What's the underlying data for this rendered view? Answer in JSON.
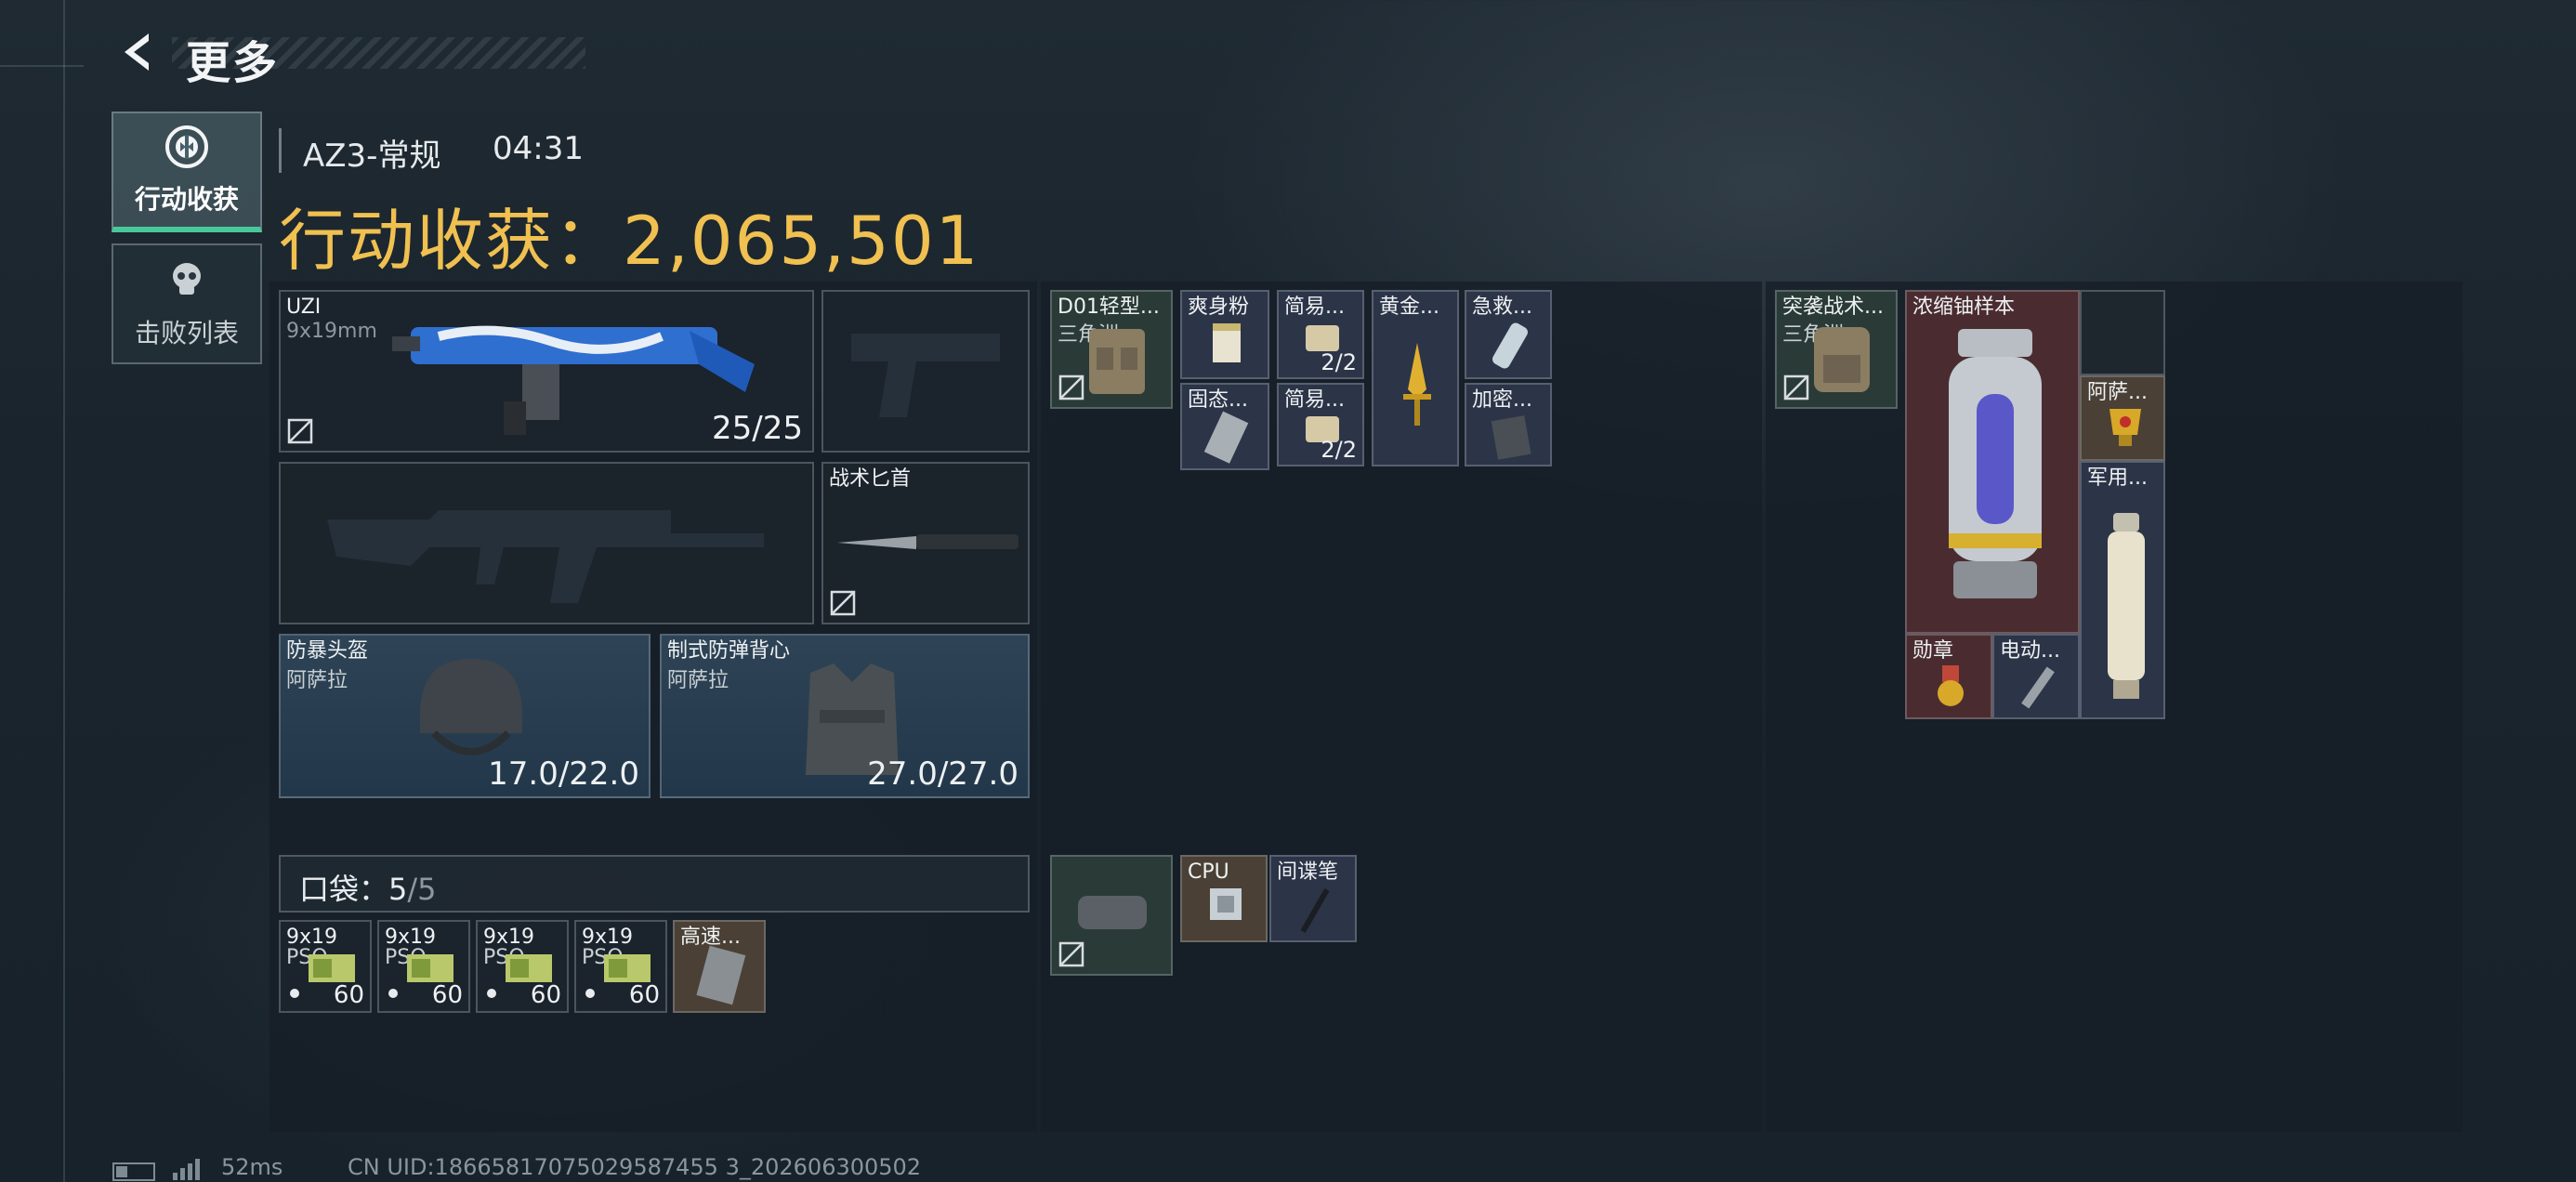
{
  "header": {
    "back_label": "更多",
    "map_name": "AZ3-常规",
    "timer": "04:31",
    "haul_label": "行动收获：",
    "haul_value": "2,065,501"
  },
  "tabs": [
    {
      "label": "行动收获",
      "icon": "target-icon",
      "active": true
    },
    {
      "label": "击败列表",
      "icon": "skull-icon",
      "active": false
    }
  ],
  "loadout": {
    "primary": {
      "name": "UZI",
      "caliber": "9x19mm",
      "ammo": "25/25"
    },
    "knife": {
      "name": "战术匕首"
    },
    "helmet": {
      "name": "防暴头盔",
      "sub": "阿萨拉",
      "durability": "17.0/22.0"
    },
    "armor": {
      "name": "制式防弹背心",
      "sub": "阿萨拉",
      "durability": "27.0/27.0"
    }
  },
  "pocket": {
    "label": "口袋：",
    "used": "5",
    "sep": "/",
    "cap": "5",
    "items": [
      {
        "name": "9x19",
        "sub": "PSO",
        "count": "60"
      },
      {
        "name": "9x19",
        "sub": "PSO",
        "count": "60"
      },
      {
        "name": "9x19",
        "sub": "PSO",
        "count": "60"
      },
      {
        "name": "9x19",
        "sub": "PSO",
        "count": "60"
      },
      {
        "name": "高速..."
      }
    ]
  },
  "chest_rig": {
    "name": "D01轻型...",
    "sub": "三角洲",
    "items": [
      {
        "name": "爽身粉"
      },
      {
        "name": "简易...",
        "count": "2/2"
      },
      {
        "name": "黄金..."
      },
      {
        "name": "急救..."
      },
      {
        "name": "固态..."
      },
      {
        "name": "简易...",
        "count": "2/2"
      },
      {
        "name": "加密..."
      }
    ]
  },
  "pouch": {
    "items": [
      {
        "name": "CPU"
      },
      {
        "name": "间谍笔"
      }
    ]
  },
  "backpack": {
    "name": "突袭战术...",
    "sub": "三角洲",
    "items": [
      {
        "name": "浓缩铀样本"
      },
      {
        "name": "阿萨..."
      },
      {
        "name": "军用..."
      },
      {
        "name": "勋章"
      },
      {
        "name": "电动..."
      }
    ]
  },
  "status": {
    "ping": "52ms",
    "uid": "CN UID:18665817075029587455 3_202606300502"
  }
}
